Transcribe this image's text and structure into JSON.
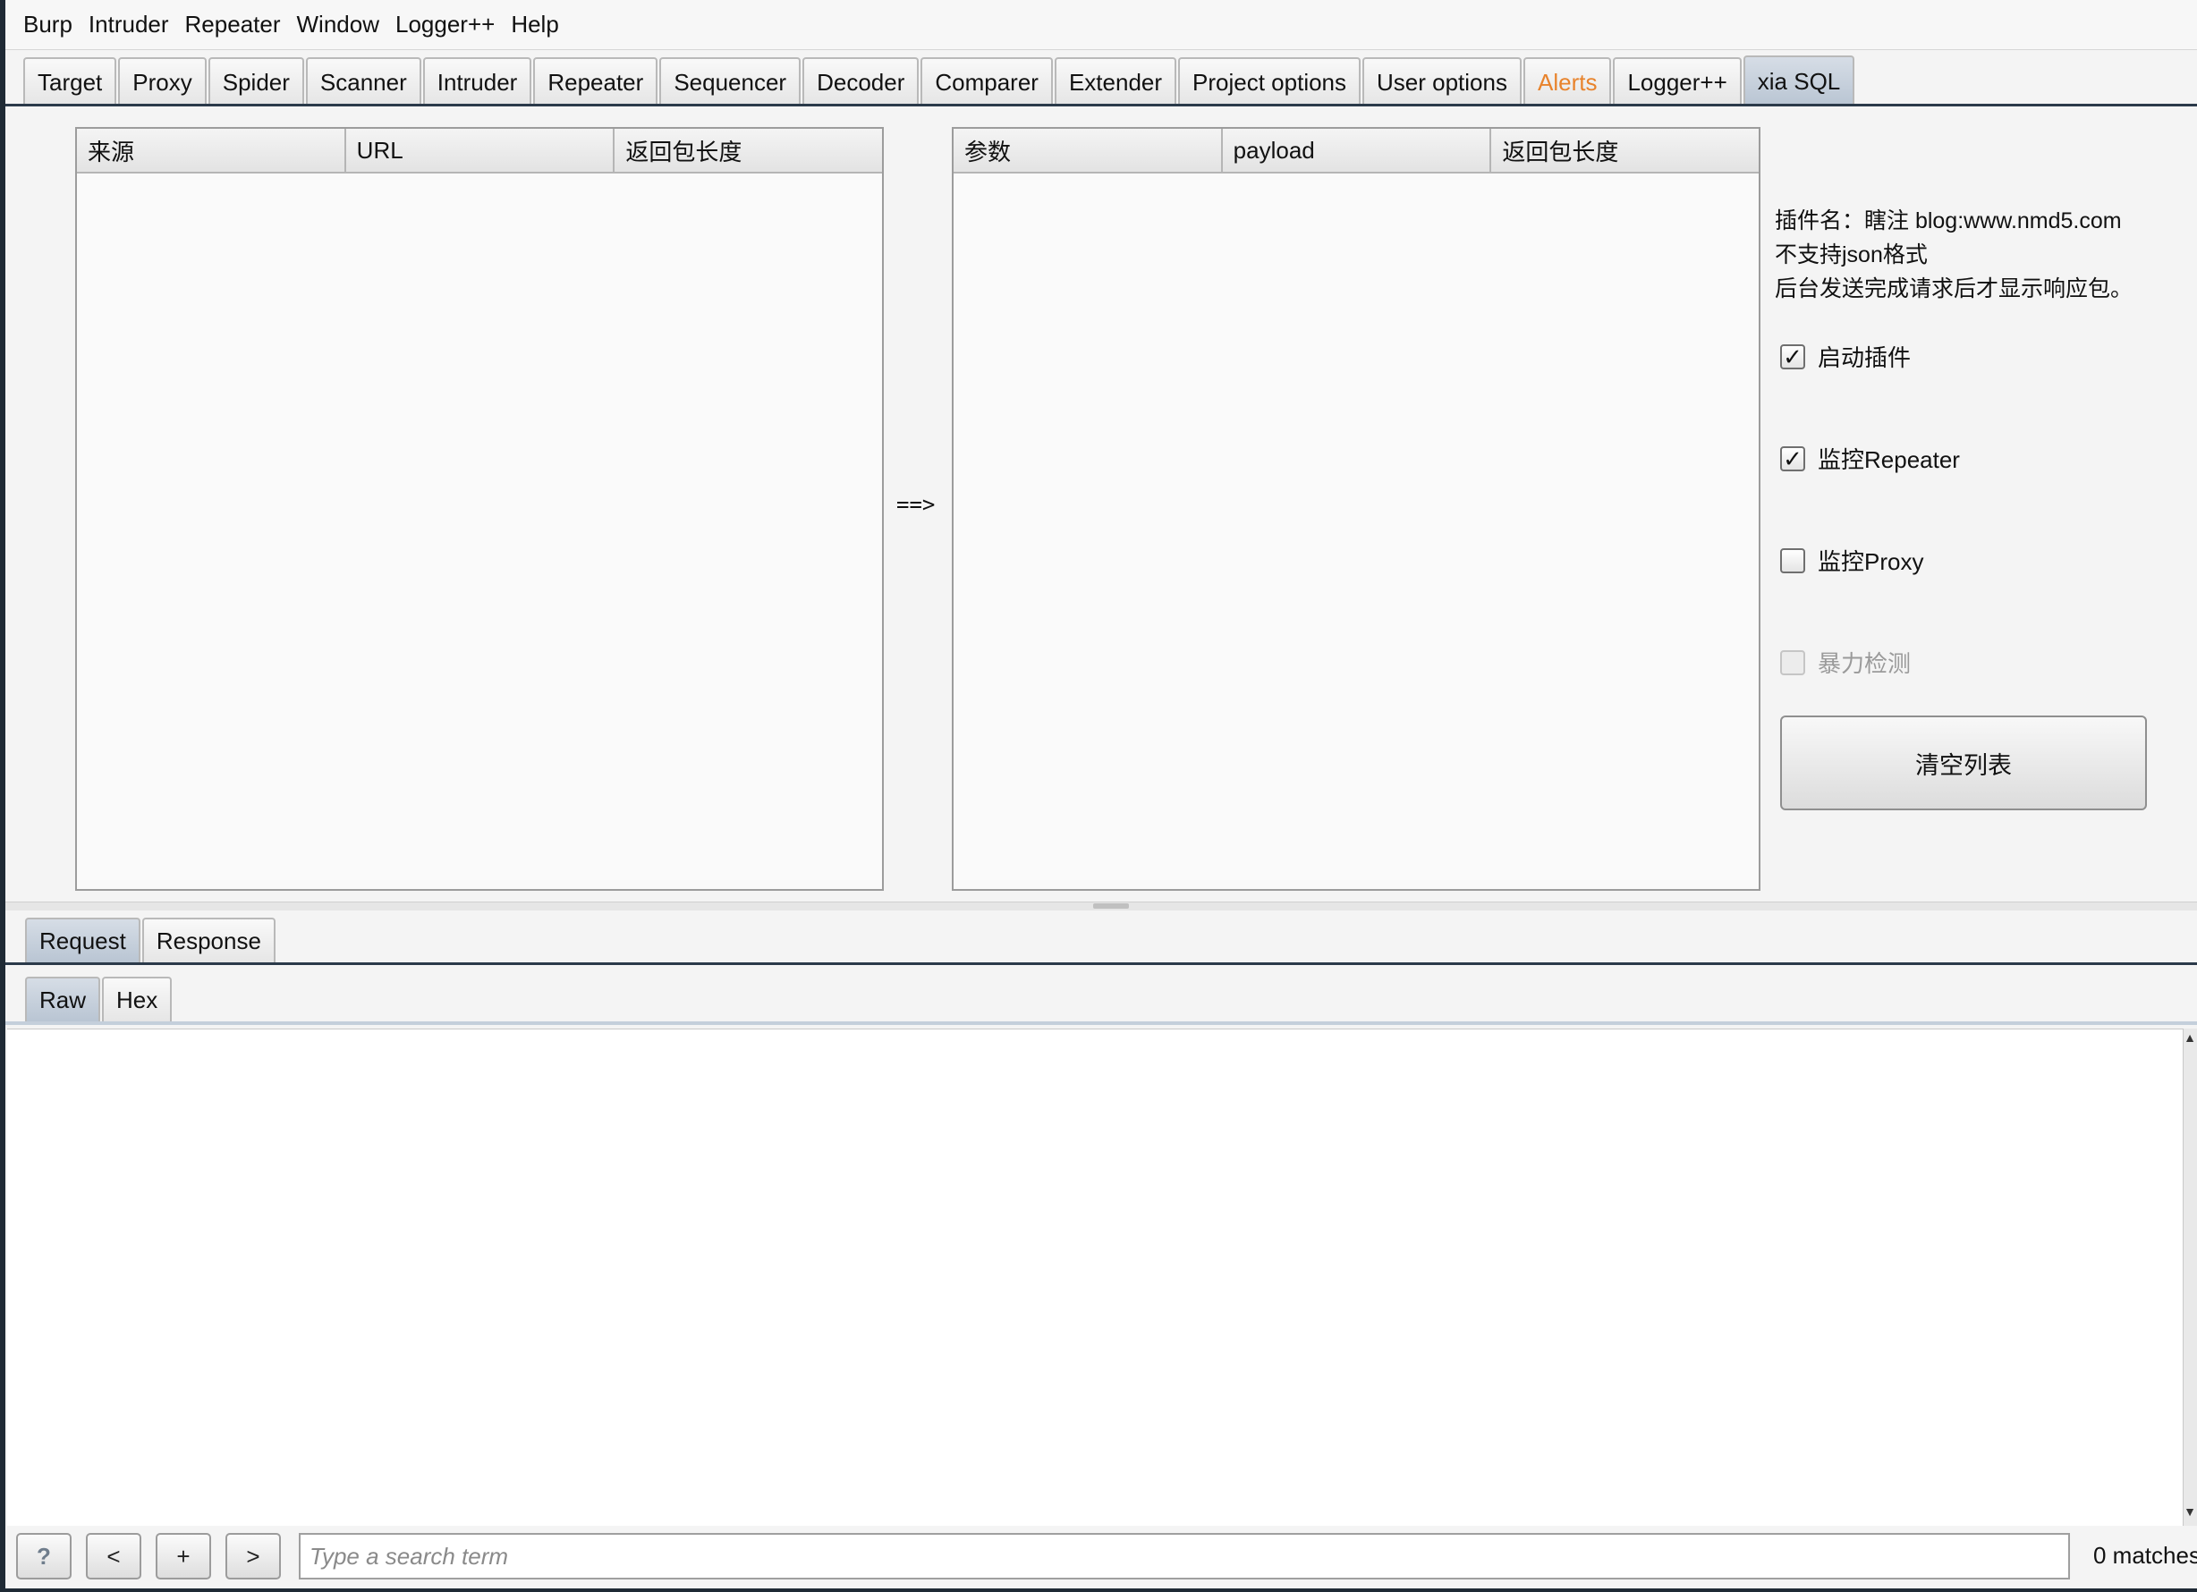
{
  "menu": [
    "Burp",
    "Intruder",
    "Repeater",
    "Window",
    "Logger++",
    "Help"
  ],
  "tabs": [
    {
      "label": "Target"
    },
    {
      "label": "Proxy"
    },
    {
      "label": "Spider"
    },
    {
      "label": "Scanner"
    },
    {
      "label": "Intruder"
    },
    {
      "label": "Repeater"
    },
    {
      "label": "Sequencer"
    },
    {
      "label": "Decoder"
    },
    {
      "label": "Comparer"
    },
    {
      "label": "Extender"
    },
    {
      "label": "Project options"
    },
    {
      "label": "User options"
    },
    {
      "label": "Alerts"
    },
    {
      "label": "Logger++"
    },
    {
      "label": "xia SQL"
    }
  ],
  "left_table": {
    "columns": [
      "来源",
      "URL",
      "返回包长度"
    ]
  },
  "arrow": "==>",
  "right_table": {
    "columns": [
      "参数",
      "payload",
      "返回包长度"
    ]
  },
  "info": {
    "line1": "插件名：瞎注 blog:www.nmd5.com",
    "line2": "不支持json格式",
    "line3": "后台发送完成请求后才显示响应包。"
  },
  "options": {
    "enable_plugin": {
      "label": "启动插件",
      "checked": true
    },
    "monitor_repeater": {
      "label": "监控Repeater",
      "checked": true
    },
    "monitor_proxy": {
      "label": "监控Proxy",
      "checked": false
    },
    "brute_force": {
      "label": "暴力检测",
      "checked": false,
      "disabled": true
    }
  },
  "clear_button": "清空列表",
  "message_tabs": {
    "request": "Request",
    "response": "Response"
  },
  "view_tabs": {
    "raw": "Raw",
    "hex": "Hex"
  },
  "search": {
    "help": "?",
    "prev": "<",
    "add": "+",
    "next": ">",
    "placeholder": "Type a search term",
    "matches": "0 matches"
  },
  "colors": {
    "alert_tab": "#e8832c",
    "active_tab": "#c7d1dd"
  }
}
